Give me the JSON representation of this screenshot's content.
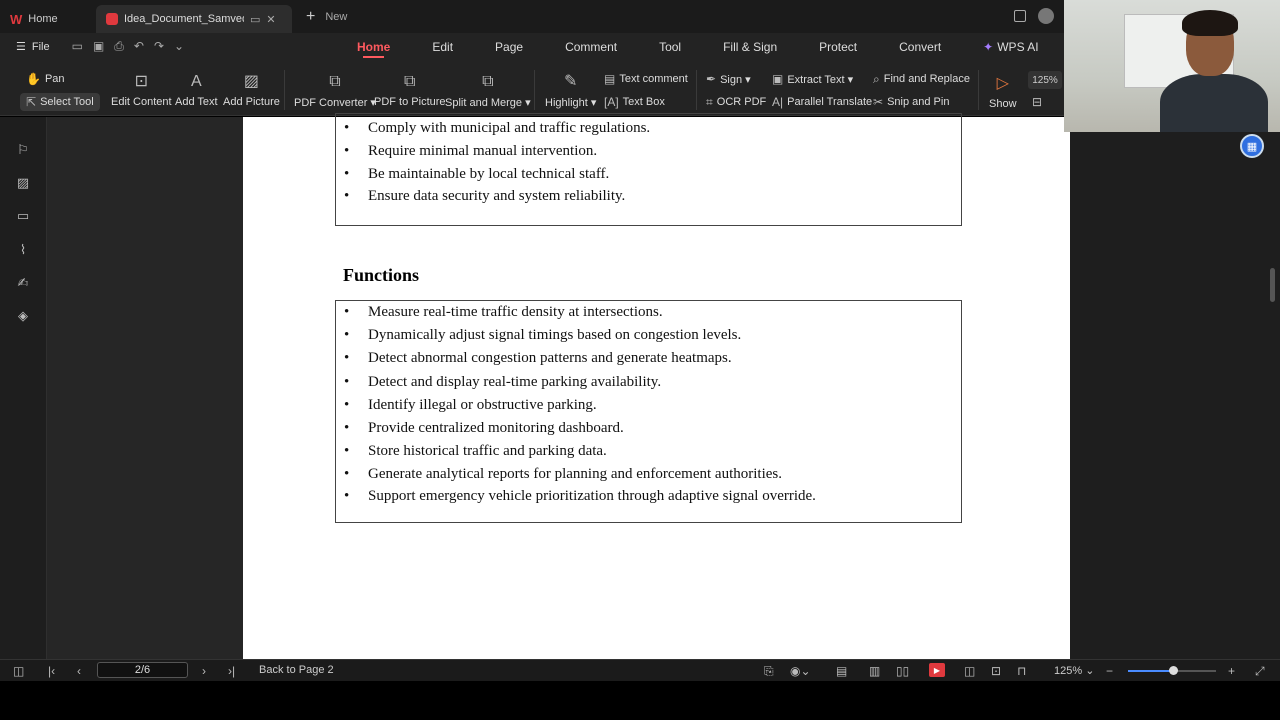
{
  "titlebar": {
    "home_tab": "Home",
    "doc_tab": "Idea_Document_Samved_Hac",
    "new_tab": "New"
  },
  "menubar": {
    "file": "File",
    "tabs": [
      "Home",
      "Edit",
      "Page",
      "Comment",
      "Tool",
      "Fill & Sign",
      "Protect",
      "Convert",
      "WPS AI"
    ],
    "active_tab": "Home"
  },
  "ribbon": {
    "pan": "Pan",
    "select_tool": "Select Tool",
    "edit_content": "Edit Content",
    "add_text": "Add Text",
    "add_picture": "Add Picture",
    "pdf_converter": "PDF Converter",
    "pdf_to_picture": "PDF to Picture",
    "split_merge": "Split and Merge",
    "highlight": "Highlight",
    "text_comment": "Text comment",
    "text_box": "Text Box",
    "sign": "Sign",
    "ocr_pdf": "OCR PDF",
    "extract_text": "Extract Text",
    "parallel_translate": "Parallel Translate",
    "find_replace": "Find and Replace",
    "snip_pin": "Snip and Pin",
    "show": "Show",
    "zoom": "125%"
  },
  "document": {
    "box1_items": [
      "Comply with municipal and traffic regulations.",
      "Require minimal manual intervention.",
      "Be maintainable by local technical staff.",
      "Ensure data security and system reliability."
    ],
    "heading": "Functions",
    "box2_items": [
      "Measure real-time traffic density at intersections.",
      "Dynamically adjust signal timings based on congestion levels.",
      "Detect abnormal congestion patterns and generate heatmaps.",
      "Detect and display real-time parking availability.",
      "Identify illegal or obstructive parking.",
      "Provide centralized monitoring dashboard.",
      "Store historical traffic and parking data.",
      "Generate analytical reports for planning and enforcement authorities.",
      "Support emergency vehicle prioritization through adaptive signal override."
    ]
  },
  "statusbar": {
    "page_indicator": "2/6",
    "back_link": "Back to Page 2",
    "zoom": "125%",
    "zoom_slider_fraction": 0.5
  },
  "colors": {
    "accent": "#ff5a5f",
    "ai": "#a57cff",
    "record": "#e0393e",
    "slider": "#4a8cff"
  }
}
